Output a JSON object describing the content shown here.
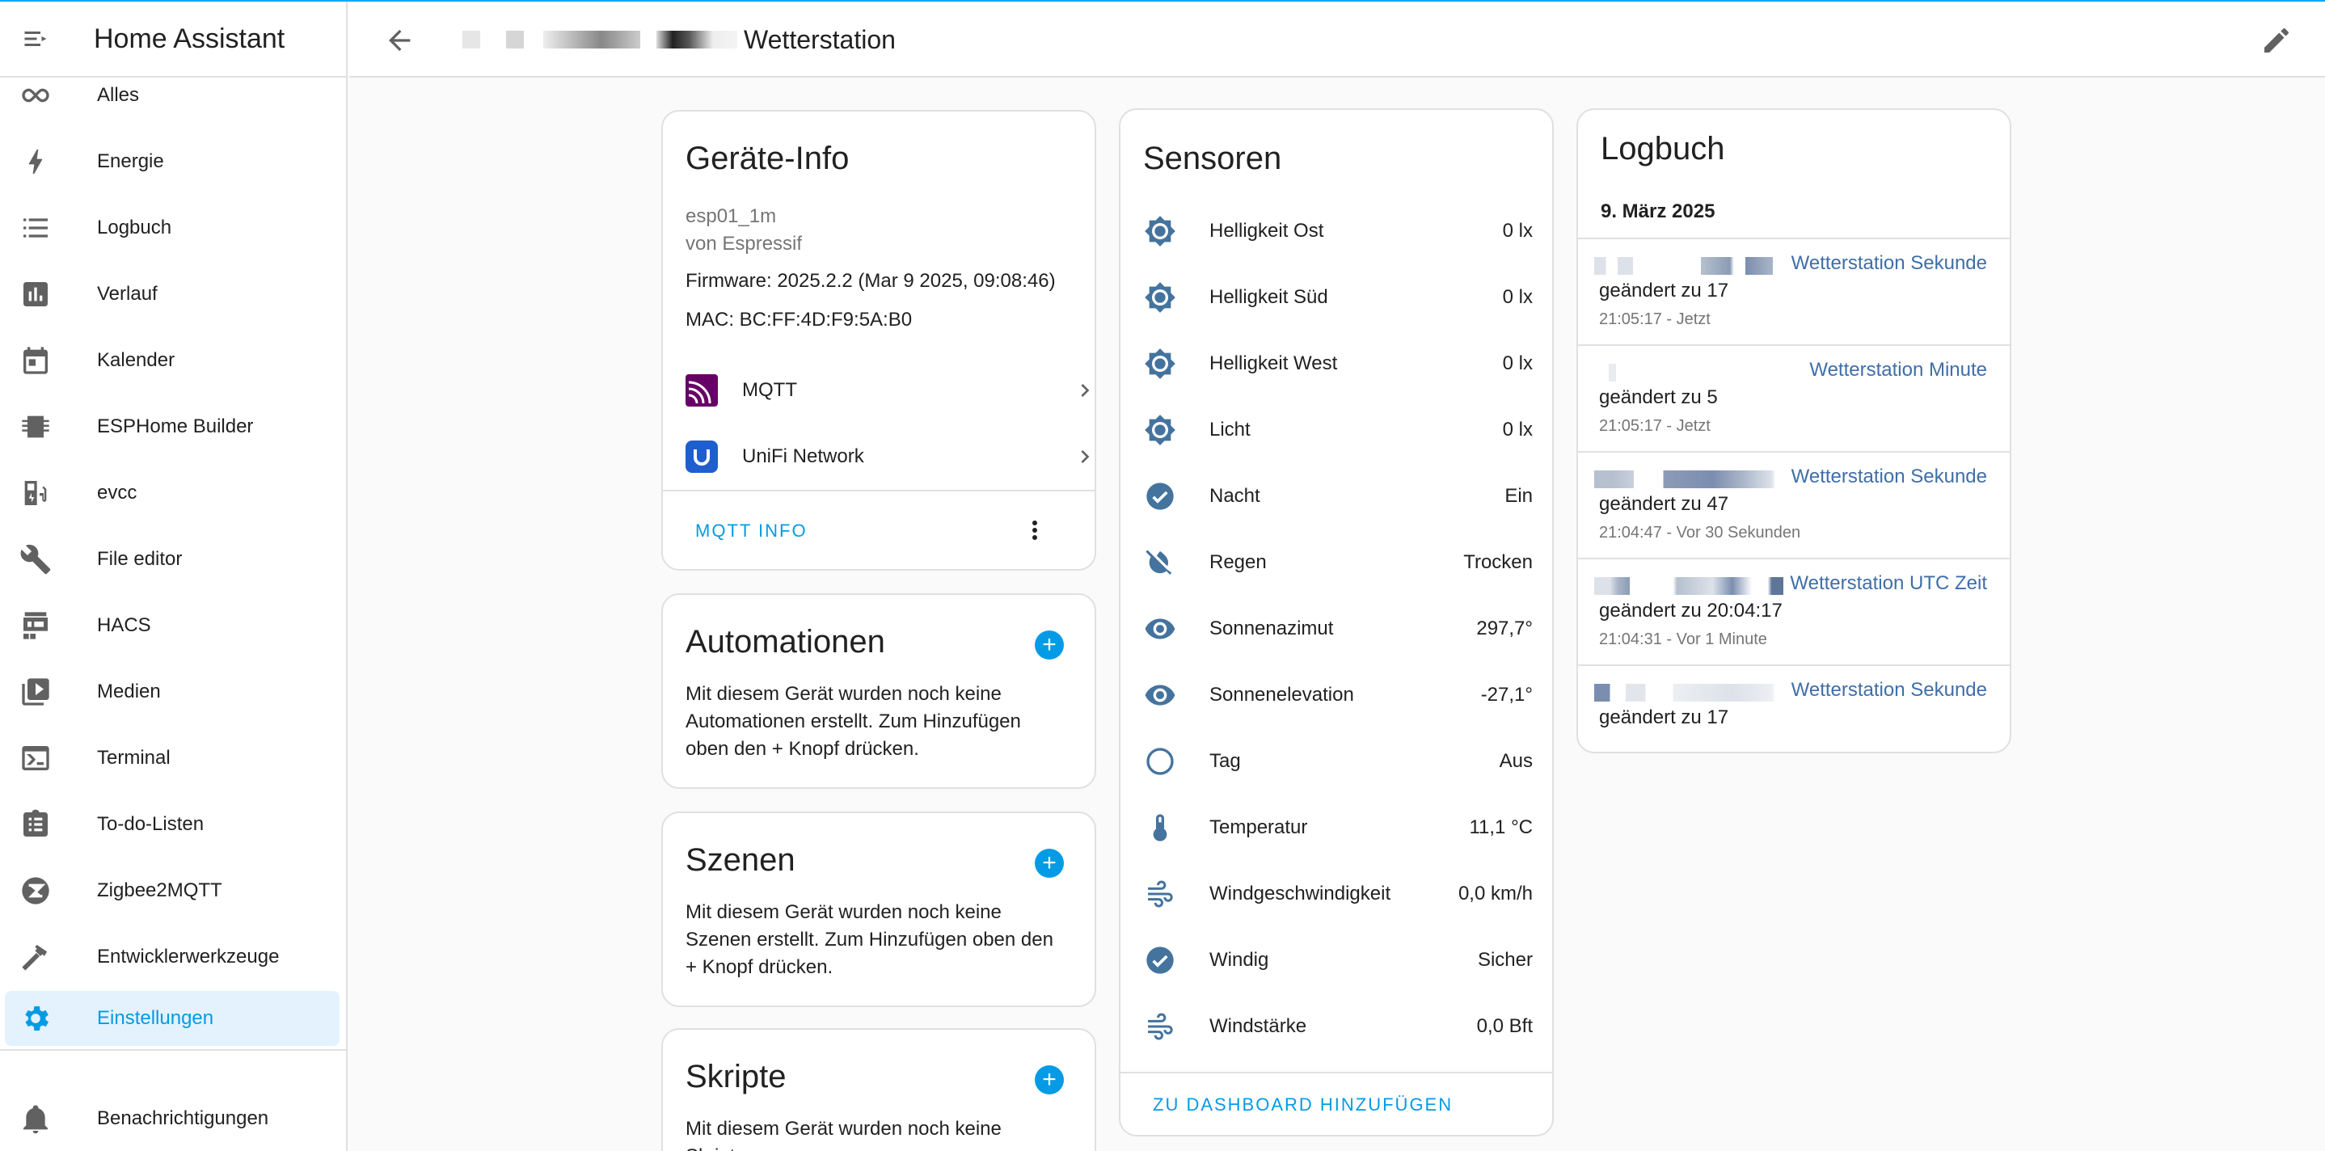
{
  "app": {
    "title": "Home Assistant"
  },
  "sidebar": {
    "items": [
      {
        "label": "Alles",
        "icon": "infinity-icon"
      },
      {
        "label": "Energie",
        "icon": "lightning-icon"
      },
      {
        "label": "Logbuch",
        "icon": "list-icon"
      },
      {
        "label": "Verlauf",
        "icon": "chart-icon"
      },
      {
        "label": "Kalender",
        "icon": "calendar-icon"
      },
      {
        "label": "ESPHome Builder",
        "icon": "chip-icon"
      },
      {
        "label": "evcc",
        "icon": "ev-station-icon"
      },
      {
        "label": "File editor",
        "icon": "wrench-icon"
      },
      {
        "label": "HACS",
        "icon": "hacs-icon"
      },
      {
        "label": "Medien",
        "icon": "media-icon"
      },
      {
        "label": "Terminal",
        "icon": "terminal-icon"
      },
      {
        "label": "To-do-Listen",
        "icon": "clipboard-list-icon"
      },
      {
        "label": "Zigbee2MQTT",
        "icon": "zigbee-icon"
      },
      {
        "label": "Entwicklerwerkzeuge",
        "icon": "hammer-icon"
      },
      {
        "label": "Einstellungen",
        "icon": "gear-icon",
        "active": true
      }
    ],
    "notifications": {
      "label": "Benachrichtigungen",
      "icon": "bell-icon"
    }
  },
  "header": {
    "title": "Wetterstation"
  },
  "device_info": {
    "title": "Geräte-Info",
    "model": "esp01_1m",
    "manufacturer": "von Espressif",
    "firmware": "Firmware: 2025.2.2 (Mar 9 2025, 09:08:46)",
    "mac": "MAC: BC:FF:4D:F9:5A:B0",
    "integrations": [
      {
        "label": "MQTT",
        "icon": "mqtt-icon"
      },
      {
        "label": "UniFi Network",
        "icon": "unifi-icon"
      }
    ],
    "action": "MQTT INFO"
  },
  "automations": {
    "title": "Automationen",
    "text": "Mit diesem Gerät wurden noch keine Automationen erstellt. Zum Hinzufügen oben den + Knopf drücken."
  },
  "scenes": {
    "title": "Szenen",
    "text": "Mit diesem Gerät wurden noch keine Szenen erstellt. Zum Hinzufügen oben den + Knopf drücken."
  },
  "scripts": {
    "title": "Skripte",
    "text": "Mit diesem Gerät wurden noch keine Skripte"
  },
  "sensors": {
    "title": "Sensoren",
    "rows": [
      {
        "name": "Helligkeit Ost",
        "value": "0 lx",
        "icon": "brightness-icon"
      },
      {
        "name": "Helligkeit Süd",
        "value": "0 lx",
        "icon": "brightness-icon"
      },
      {
        "name": "Helligkeit West",
        "value": "0 lx",
        "icon": "brightness-icon"
      },
      {
        "name": "Licht",
        "value": "0 lx",
        "icon": "brightness-icon"
      },
      {
        "name": "Nacht",
        "value": "Ein",
        "icon": "check-circle-icon"
      },
      {
        "name": "Regen",
        "value": "Trocken",
        "icon": "water-off-icon"
      },
      {
        "name": "Sonnenazimut",
        "value": "297,7°",
        "icon": "eye-icon"
      },
      {
        "name": "Sonnenelevation",
        "value": "-27,1°",
        "icon": "eye-icon"
      },
      {
        "name": "Tag",
        "value": "Aus",
        "icon": "circle-outline-icon"
      },
      {
        "name": "Temperatur",
        "value": "11,1 °C",
        "icon": "thermometer-icon"
      },
      {
        "name": "Windgeschwindigkeit",
        "value": "0,0 km/h",
        "icon": "wind-icon"
      },
      {
        "name": "Windig",
        "value": "Sicher",
        "icon": "check-circle-icon"
      },
      {
        "name": "Windstärke",
        "value": "0,0 Bft",
        "icon": "wind-icon"
      }
    ],
    "action": "ZU DASHBOARD HINZUFÜGEN"
  },
  "logbook": {
    "title": "Logbuch",
    "date": "9. März 2025",
    "entries": [
      {
        "entity": "Wetterstation Sekunde",
        "state": "geändert zu 17",
        "time": "21:05:17 - Jetzt"
      },
      {
        "entity": "Wetterstation Minute",
        "state": "geändert zu 5",
        "time": "21:05:17 - Jetzt"
      },
      {
        "entity": "Wetterstation Sekunde",
        "state": "geändert zu 47",
        "time": "21:04:47 - Vor 30 Sekunden"
      },
      {
        "entity": "Wetterstation UTC Zeit",
        "state": "geändert zu 20:04:17",
        "time": "21:04:31 - Vor 1 Minute"
      },
      {
        "entity": "Wetterstation Sekunde",
        "state": "geändert zu 17",
        "time": ""
      }
    ]
  },
  "colors": {
    "accent": "#039be5",
    "icon": "#44739e",
    "link": "#3f6ea8",
    "mqtt": "#660066",
    "unifi": "#1f5ecf"
  }
}
